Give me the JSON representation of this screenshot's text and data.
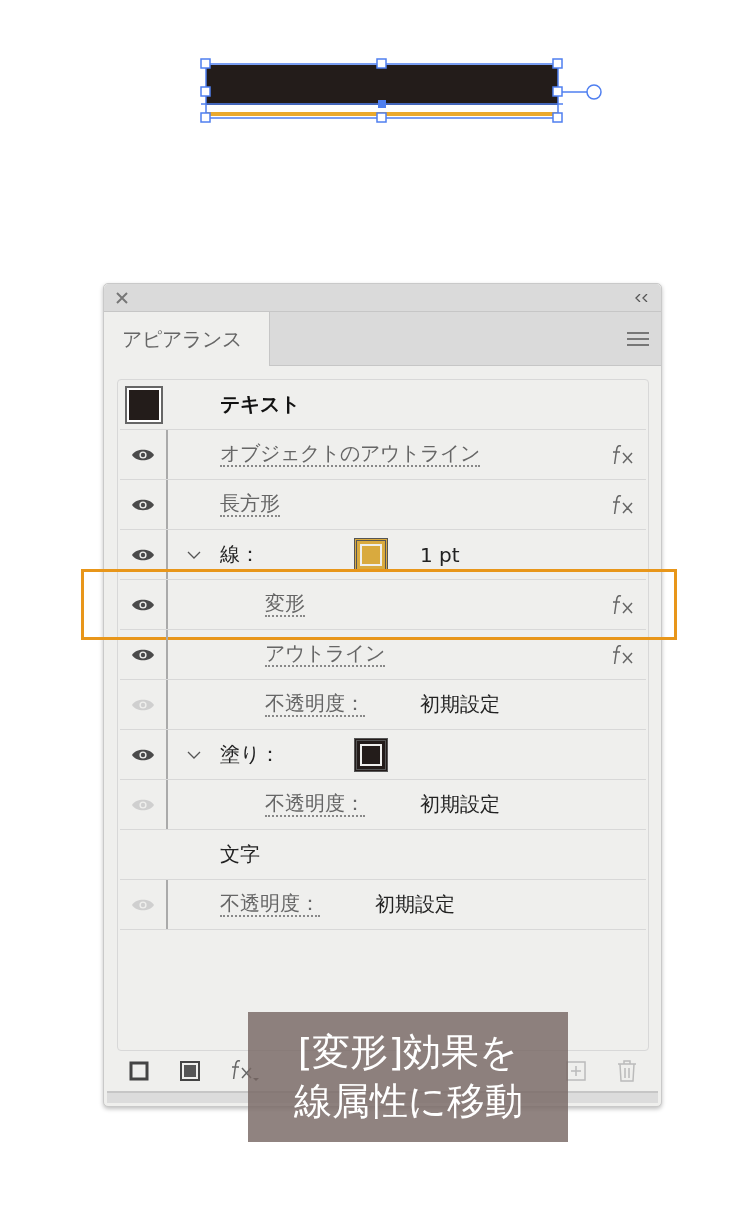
{
  "panel": {
    "tab": {
      "label": "アピアランス",
      "selected": true
    }
  },
  "rows": [
    {
      "kind": "object",
      "label": "テキスト",
      "color": "#231c1a"
    },
    {
      "kind": "effect",
      "label": "オブジェクトのアウトライン",
      "visible": true
    },
    {
      "kind": "effect",
      "label": "長方形",
      "visible": true
    },
    {
      "kind": "stroke",
      "label": "線：",
      "visible": true,
      "expanded": true,
      "color": "#d9aa3e",
      "value": "1 pt",
      "children": [
        {
          "kind": "effect",
          "label": "変形",
          "visible": true,
          "highlighted": true
        },
        {
          "kind": "effect",
          "label": "アウトライン",
          "visible": true
        },
        {
          "kind": "opacity",
          "label": "不透明度：",
          "value": "初期設定",
          "visible": false
        }
      ]
    },
    {
      "kind": "fill",
      "label": "塗り：",
      "visible": true,
      "expanded": true,
      "color": "#231c1a",
      "children": [
        {
          "kind": "opacity",
          "label": "不透明度：",
          "value": "初期設定",
          "visible": false
        }
      ]
    },
    {
      "kind": "characters",
      "label": "文字"
    },
    {
      "kind": "opacity",
      "label": "不透明度：",
      "value": "初期設定",
      "visible": false
    }
  ],
  "caption": {
    "lines": [
      "[変形]効果を",
      "線属性に移動"
    ]
  }
}
